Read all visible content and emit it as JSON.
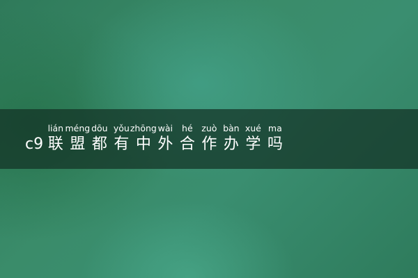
{
  "title": {
    "prefix": "c9",
    "chars": [
      {
        "hanzi": "联",
        "pinyin": "lián"
      },
      {
        "hanzi": "盟",
        "pinyin": "méng"
      },
      {
        "hanzi": "都",
        "pinyin": "dōu"
      },
      {
        "hanzi": "有",
        "pinyin": "yǒu"
      },
      {
        "hanzi": "中",
        "pinyin": "zhōng"
      },
      {
        "hanzi": "外",
        "pinyin": "wài"
      },
      {
        "hanzi": "合",
        "pinyin": "hé"
      },
      {
        "hanzi": "作",
        "pinyin": "zuò"
      },
      {
        "hanzi": "办",
        "pinyin": "bàn"
      },
      {
        "hanzi": "学",
        "pinyin": "xué"
      },
      {
        "hanzi": "吗",
        "pinyin": "ma"
      }
    ]
  },
  "colors": {
    "banner": "#14322a",
    "text": "#ffffff",
    "background": "#3a8c6a"
  }
}
